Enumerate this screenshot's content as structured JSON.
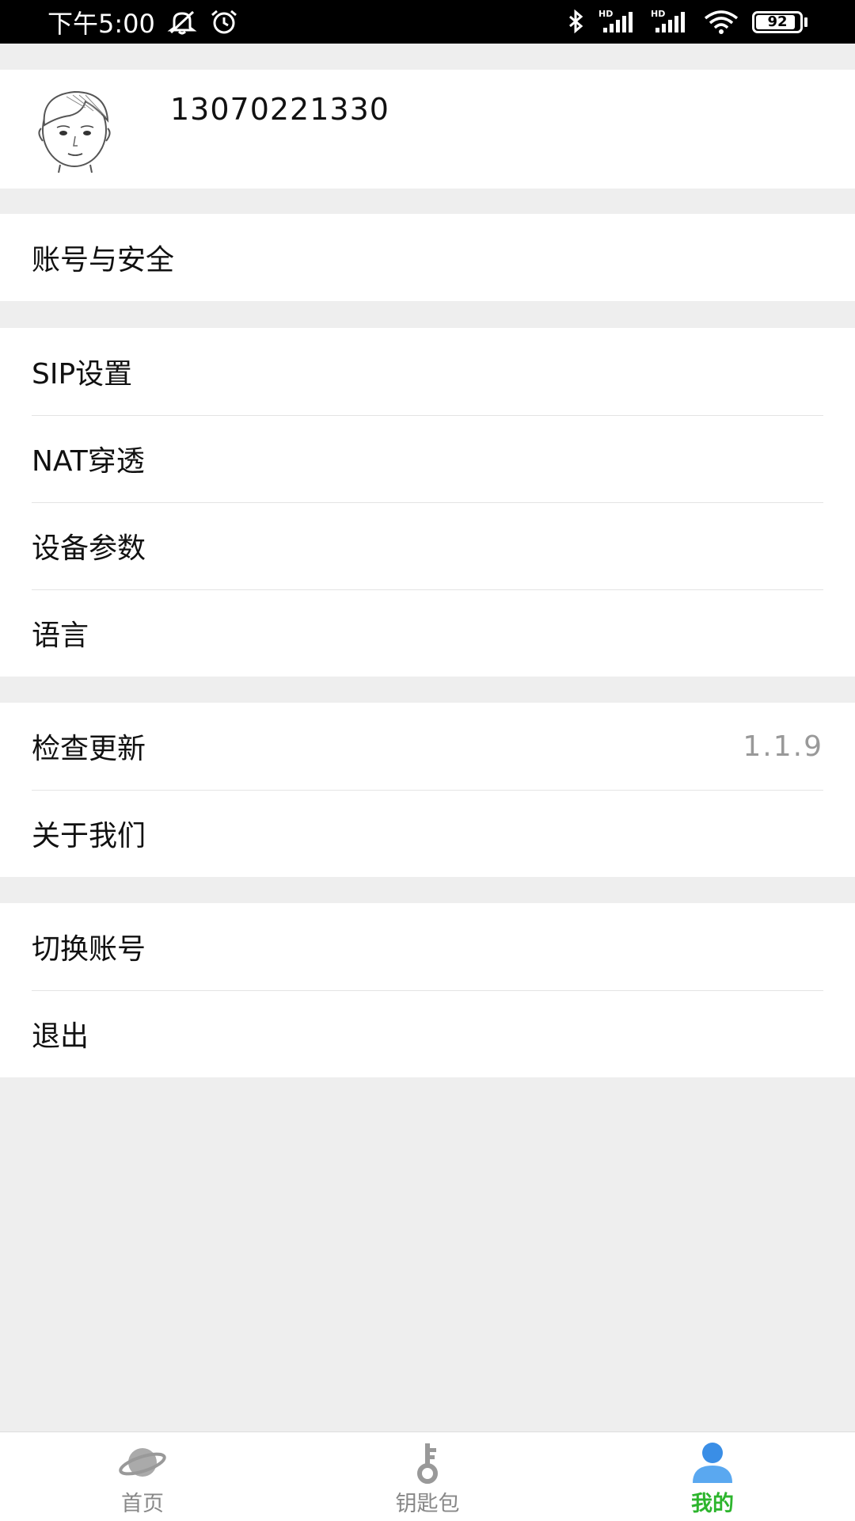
{
  "status_bar": {
    "time": "下午5:00",
    "battery": "92",
    "battery_level": 0.92
  },
  "profile": {
    "phone": "13070221330",
    "avatar_icon": "avatar-face-icon"
  },
  "menu": {
    "account_security": "账号与安全",
    "sip_settings": "SIP设置",
    "nat": "NAT穿透",
    "device_params": "设备参数",
    "language": "语言",
    "check_update": "检查更新",
    "version": "1.1.9",
    "about": "关于我们",
    "switch_account": "切换账号",
    "logout": "退出"
  },
  "tabs": [
    {
      "label": "首页",
      "icon": "planet-icon",
      "active": false
    },
    {
      "label": "钥匙包",
      "icon": "key-icon",
      "active": false
    },
    {
      "label": "我的",
      "icon": "user-icon",
      "active": true
    }
  ],
  "colors": {
    "active_tab": "#2db52d",
    "active_icon": "#3a8ee6",
    "background": "#eeeeee"
  }
}
